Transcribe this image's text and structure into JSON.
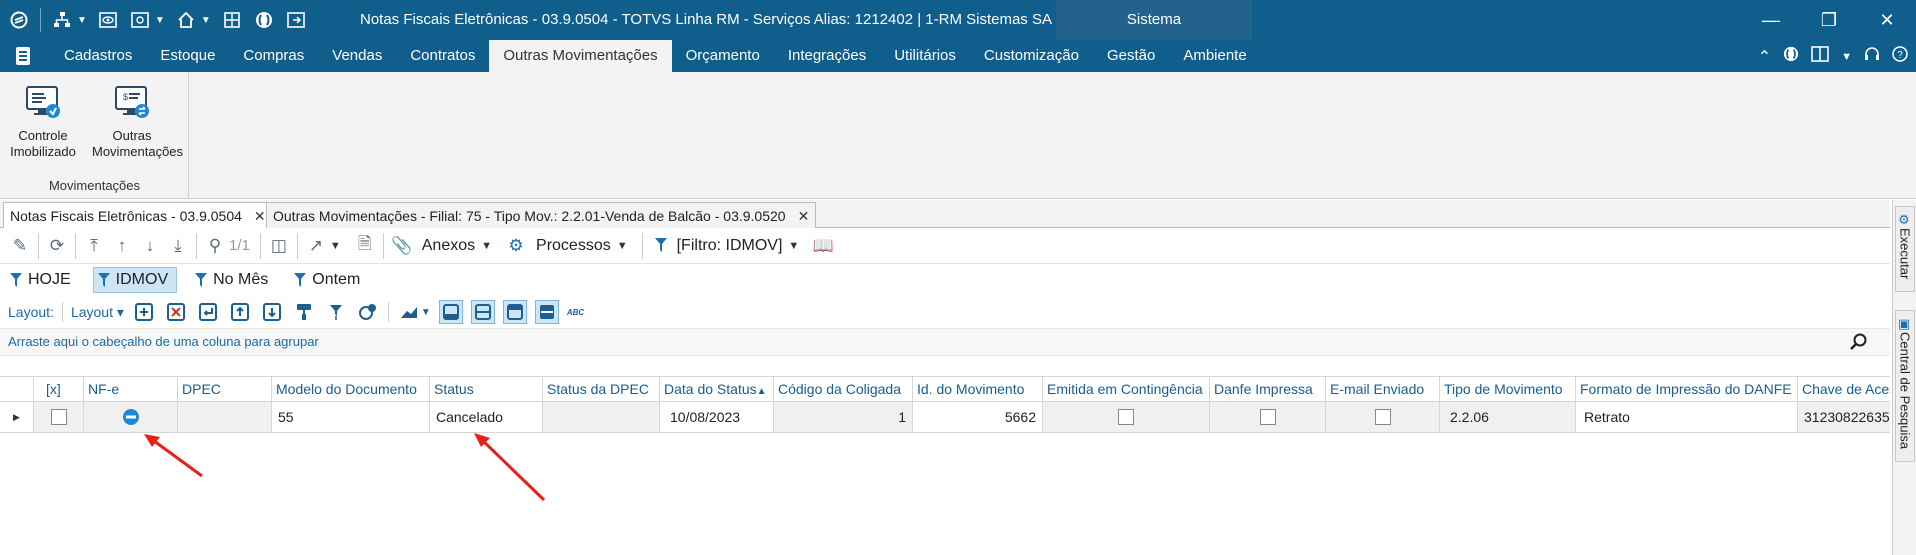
{
  "titlebar": {
    "title": "Notas Fiscais Eletrônicas - 03.9.0504 - TOTVS Linha RM - Serviços  Alias:  1212402 | 1-RM Sistemas SA",
    "system_label": "Sistema",
    "quick_access_icons": [
      "totvs-logo-icon",
      "sitemap-icon",
      "eye-icon",
      "window-icon",
      "home-icon",
      "grid-icon",
      "totvs-icon",
      "export-icon"
    ]
  },
  "menu": {
    "items": [
      "Cadastros",
      "Estoque",
      "Compras",
      "Vendas",
      "Contratos",
      "Outras Movimentações",
      "Orçamento",
      "Integrações",
      "Utilitários",
      "Customização",
      "Gestão",
      "Ambiente"
    ],
    "active": "Outras Movimentações"
  },
  "ribbon": {
    "buttons": [
      {
        "label_line1": "Controle",
        "label_line2": "Imobilizado",
        "icon": "monitor-gear-icon"
      },
      {
        "label_line1": "Outras",
        "label_line2": "Movimentações",
        "icon": "monitor-money-icon"
      }
    ],
    "group_label": "Movimentações"
  },
  "tabs": [
    {
      "label": "Notas Fiscais Eletrônicas - 03.9.0504",
      "active": true
    },
    {
      "label": "Outras Movimentações - Filial: 75 - Tipo Mov.: 2.2.01-Venda de Balcão - 03.9.0520",
      "active": false
    }
  ],
  "toolbar": {
    "page": "1/1",
    "anexos": "Anexos",
    "processos": "Processos",
    "filtro": "[Filtro: IDMOV]"
  },
  "filters": [
    {
      "label": "HOJE",
      "selected": false
    },
    {
      "label": "IDMOV",
      "selected": true
    },
    {
      "label": "No Mês",
      "selected": false
    },
    {
      "label": "Ontem",
      "selected": false
    }
  ],
  "layoutbar": {
    "label": "Layout:",
    "dropdown": "Layout",
    "abc": "ABC"
  },
  "groupbar": {
    "text": "Arraste aqui o cabeçalho de uma coluna para agrupar"
  },
  "grid": {
    "columns": [
      "[x]",
      "NF-e",
      "DPEC",
      "Modelo do Documento",
      "Status",
      "Status da DPEC",
      "Data do Status",
      "Código da Coligada",
      "Id. do Movimento",
      "Emitida em Contingência",
      "Danfe Impressa",
      "E-mail Enviado",
      "Tipo de Movimento",
      "Formato de Impressão do DANFE",
      "Chave de Acesso"
    ],
    "row": {
      "modelo": "55",
      "status": "Cancelado",
      "data_status": "10/08/2023",
      "coligada": "1",
      "id_movimento": "5662",
      "tipo_movimento": "2.2.06",
      "formato": "Retrato",
      "chave": "31230822635"
    }
  },
  "side_panel": {
    "executar": "Executar",
    "central": "Central de Pesquisa"
  },
  "colors": {
    "titlebar": "#0f5e8b",
    "accent": "#1a6aa6",
    "annotation": "#e8201a",
    "status_icon": "#1e88d2"
  }
}
